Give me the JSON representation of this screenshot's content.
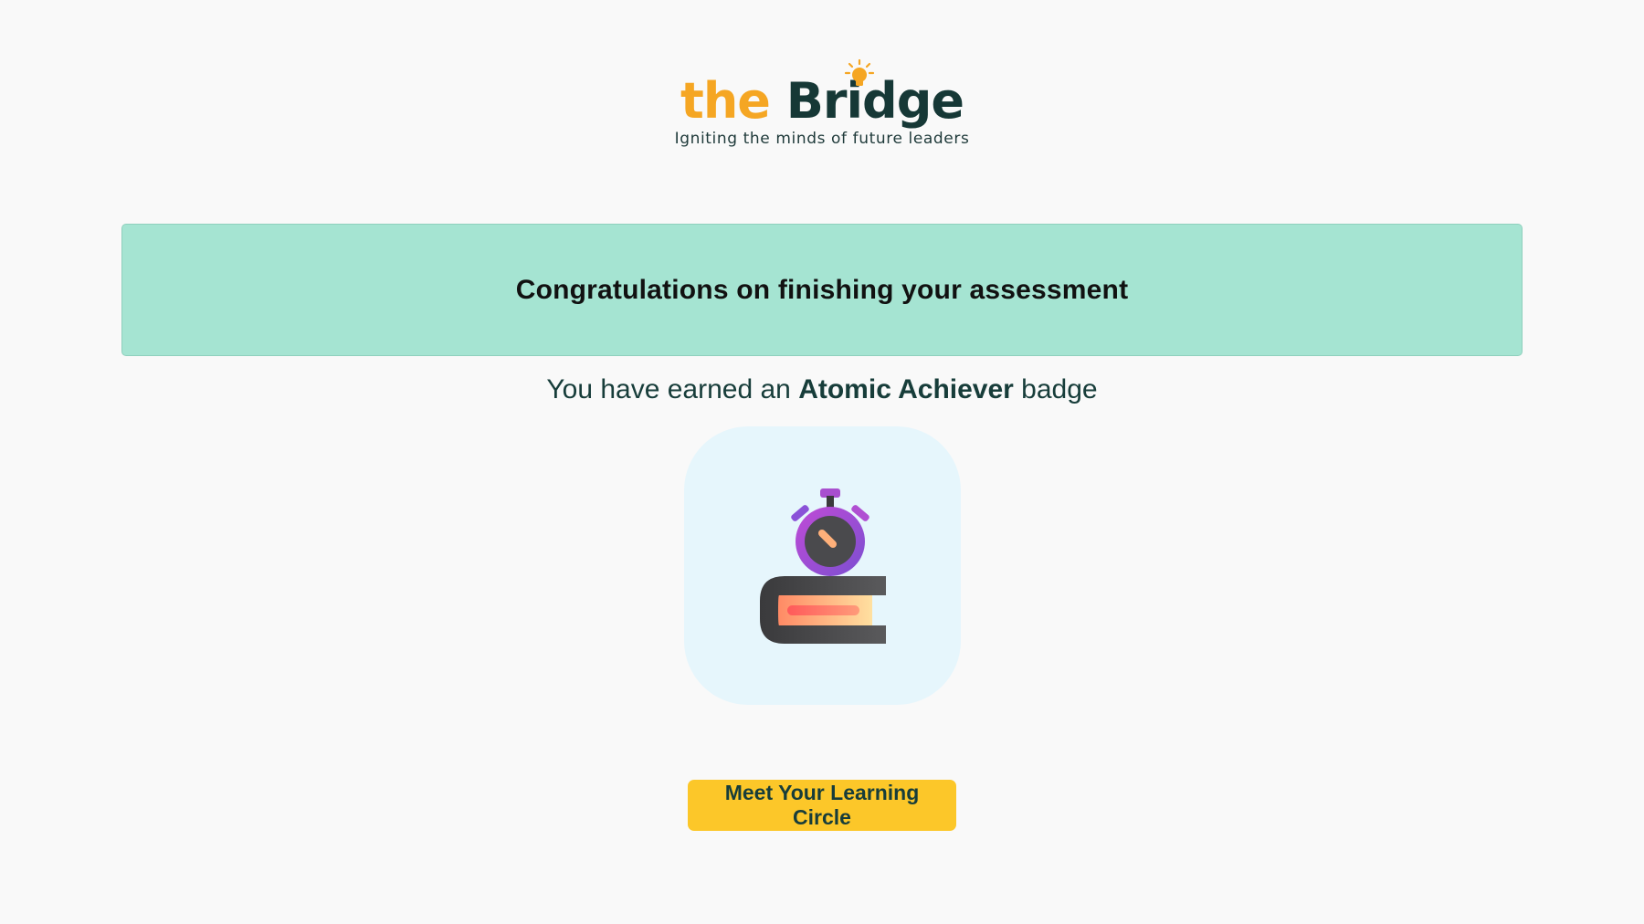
{
  "brand": {
    "logo_the": "the",
    "logo_bridge": "Bridge",
    "tagline": "Igniting the minds of future leaders",
    "accent_color": "#f5a623",
    "dark_color": "#163836"
  },
  "banner": {
    "message": "Congratulations on finishing your assessment",
    "background_color": "#a5e4d2"
  },
  "badge": {
    "prefix": "You have earned an ",
    "name": "Atomic Achiever",
    "suffix": " badge",
    "icon": "stopwatch-on-book-icon"
  },
  "cta": {
    "label": "Meet Your Learning Circle",
    "color": "#fcc729"
  }
}
